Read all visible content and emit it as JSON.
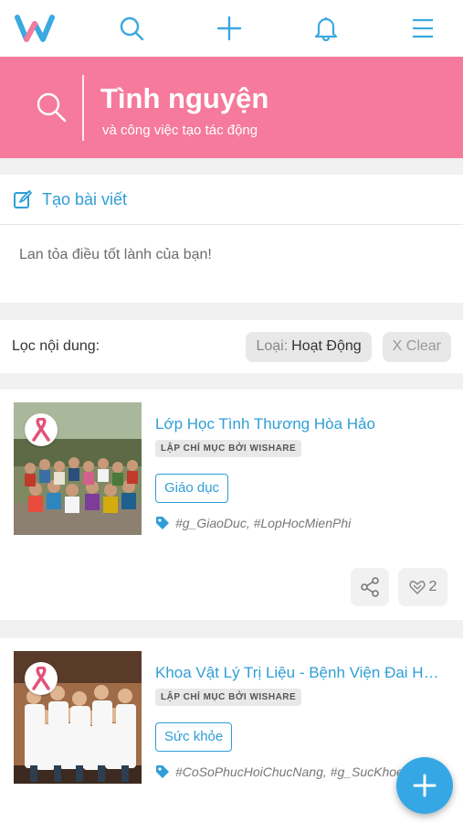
{
  "colors": {
    "brand_pink": "#f57a9c",
    "accent_blue": "#2f9ed6",
    "fab_blue": "#35a7e5"
  },
  "topbar": {
    "icons": [
      "wishare-logo",
      "search-icon",
      "plus-icon",
      "bell-icon",
      "menu-icon"
    ]
  },
  "hero": {
    "title": "Tình nguyện",
    "subtitle": "và công việc tạo tác động"
  },
  "compose": {
    "label": "Tạo bài viết",
    "placeholder": "Lan tỏa điều tốt lành của bạn!"
  },
  "filter": {
    "label": "Lọc nội dung:",
    "type_key": "Loại:",
    "type_value": "Hoạt Động",
    "clear_label": "X Clear"
  },
  "cards": [
    {
      "title": "Lớp Học Tình Thương Hòa Hảo",
      "badge": "LẬP CHỈ MỤC BỞI WISHARE",
      "category": "Giáo dục",
      "tags": "#g_GiaoDuc, #LopHocMienPhi",
      "like_count": "2"
    },
    {
      "title": "Khoa Vật Lý Trị Liệu - Bệnh Viện Đai Học...",
      "badge": "LẬP CHỈ MỤC BỞI WISHARE",
      "category": "Sức khỏe",
      "tags": "#CoSoPhucHoiChucNang, #g_SucKhoe"
    }
  ]
}
